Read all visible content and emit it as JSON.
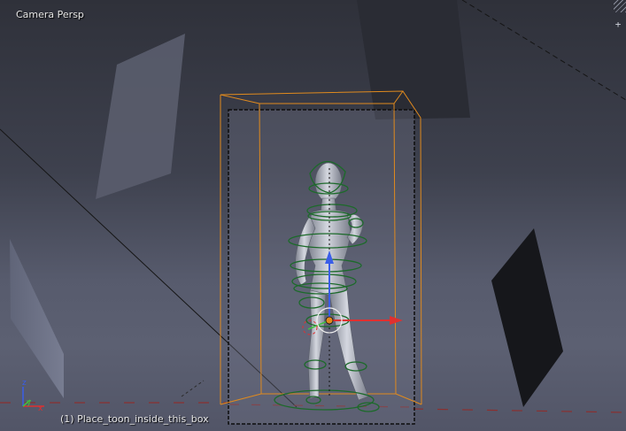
{
  "viewport": {
    "view_label": "Camera Persp",
    "active_object": "(1) Place_toon_inside_this_box",
    "corner_widget": "+"
  },
  "axes": {
    "x": "x",
    "y": "y",
    "z": "z"
  },
  "colors": {
    "axis_x": "#e03030",
    "axis_y": "#40c040",
    "axis_z": "#3a5ee8",
    "selection_outline": "#e08a1e",
    "armature": "#1c6a2a",
    "figure": "#b8bcc8"
  }
}
